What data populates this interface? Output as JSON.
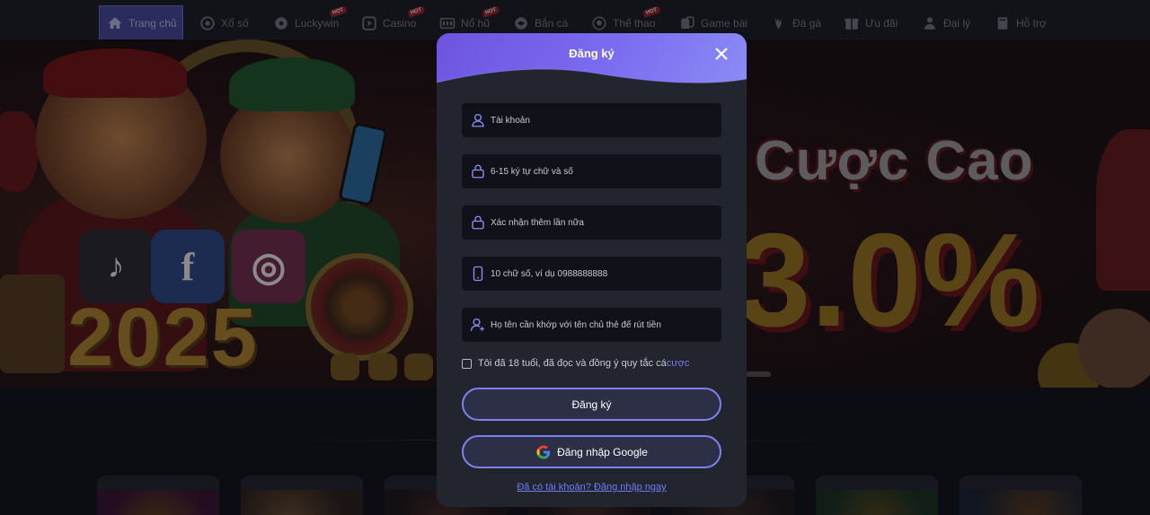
{
  "nav": {
    "items": [
      {
        "label": "Trang chủ",
        "icon": "home-icon",
        "active": true,
        "badge": ""
      },
      {
        "label": "Xổ số",
        "icon": "lottery-icon",
        "active": false,
        "badge": ""
      },
      {
        "label": "Luckywin",
        "icon": "luckywin-icon",
        "active": false,
        "badge": "HOT"
      },
      {
        "label": "Casino",
        "icon": "casino-icon",
        "active": false,
        "badge": "HOT"
      },
      {
        "label": "Nổ hũ",
        "icon": "slot-icon",
        "active": false,
        "badge": "HOT"
      },
      {
        "label": "Bắn cá",
        "icon": "fish-icon",
        "active": false,
        "badge": ""
      },
      {
        "label": "Thể thao",
        "icon": "sports-icon",
        "active": false,
        "badge": "HOT"
      },
      {
        "label": "Game bài",
        "icon": "cards-icon",
        "active": false,
        "badge": ""
      },
      {
        "label": "Đá gà",
        "icon": "rooster-icon",
        "active": false,
        "badge": ""
      },
      {
        "label": "Ưu đãi",
        "icon": "gift-icon",
        "active": false,
        "badge": ""
      },
      {
        "label": "Đại lý",
        "icon": "agent-icon",
        "active": false,
        "badge": ""
      },
      {
        "label": "Hỗ trợ",
        "icon": "support-icon",
        "active": false,
        "badge": ""
      }
    ]
  },
  "banner": {
    "year_text": "2025",
    "promo_line": "Cược Cao",
    "promo_value": "3.0%"
  },
  "modal": {
    "title": "Đăng ký",
    "fields": [
      {
        "placeholder": "Tài khoản",
        "icon": "user-icon"
      },
      {
        "placeholder": "6-15 ký tự chữ và số",
        "icon": "lock-icon"
      },
      {
        "placeholder": "Xác nhận thêm lần nữa",
        "icon": "lock-icon"
      },
      {
        "placeholder": "10 chữ số, ví dụ 0988888888",
        "icon": "phone-icon"
      },
      {
        "placeholder": "Họ tên cần khớp với tên chủ thẻ để rút tiền",
        "icon": "user-add-icon"
      }
    ],
    "agree_text": "Tôi đã 18 tuổi, đã đọc và đồng ý quy tắc cá",
    "agree_link": "cược",
    "register_button": "Đăng ký",
    "google_button": "Đăng nhập Google",
    "login_link": "Đã có tài khoản? Đăng nhập ngay"
  },
  "colors": {
    "accent": "#7b82f0",
    "header_gradient_start": "#6e54e0",
    "link": "#6f7bf7",
    "modal_bg": "#23252e",
    "input_bg": "#111219"
  }
}
